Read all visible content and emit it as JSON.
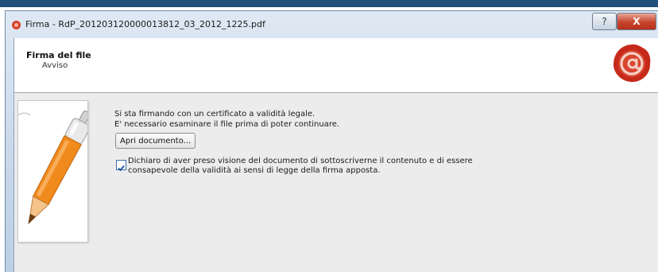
{
  "window": {
    "title": "Firma - RdP_201203120000013812_03_2012_1225.pdf",
    "help_label": "?",
    "close_label": "X"
  },
  "header": {
    "title": "Firma del file",
    "subtitle": "Avviso",
    "logo_icon": "wax-seal-at-icon"
  },
  "content": {
    "message_line1": "Si sta firmando con un certificato a validità legale.",
    "message_line2": "E' necessario esaminare il file prima di poter continuare.",
    "open_button_label": "Apri documento...",
    "declaration": {
      "checked": true,
      "line1": "Dichiaro di aver preso visione del documento di sottoscriverne il contenuto e di essere",
      "line2": "consapevole della validità ai sensi di legge della firma apposta."
    }
  },
  "colors": {
    "accent": "#f08a1c",
    "close_button": "#c7442c",
    "seal": "#c62a1a"
  }
}
